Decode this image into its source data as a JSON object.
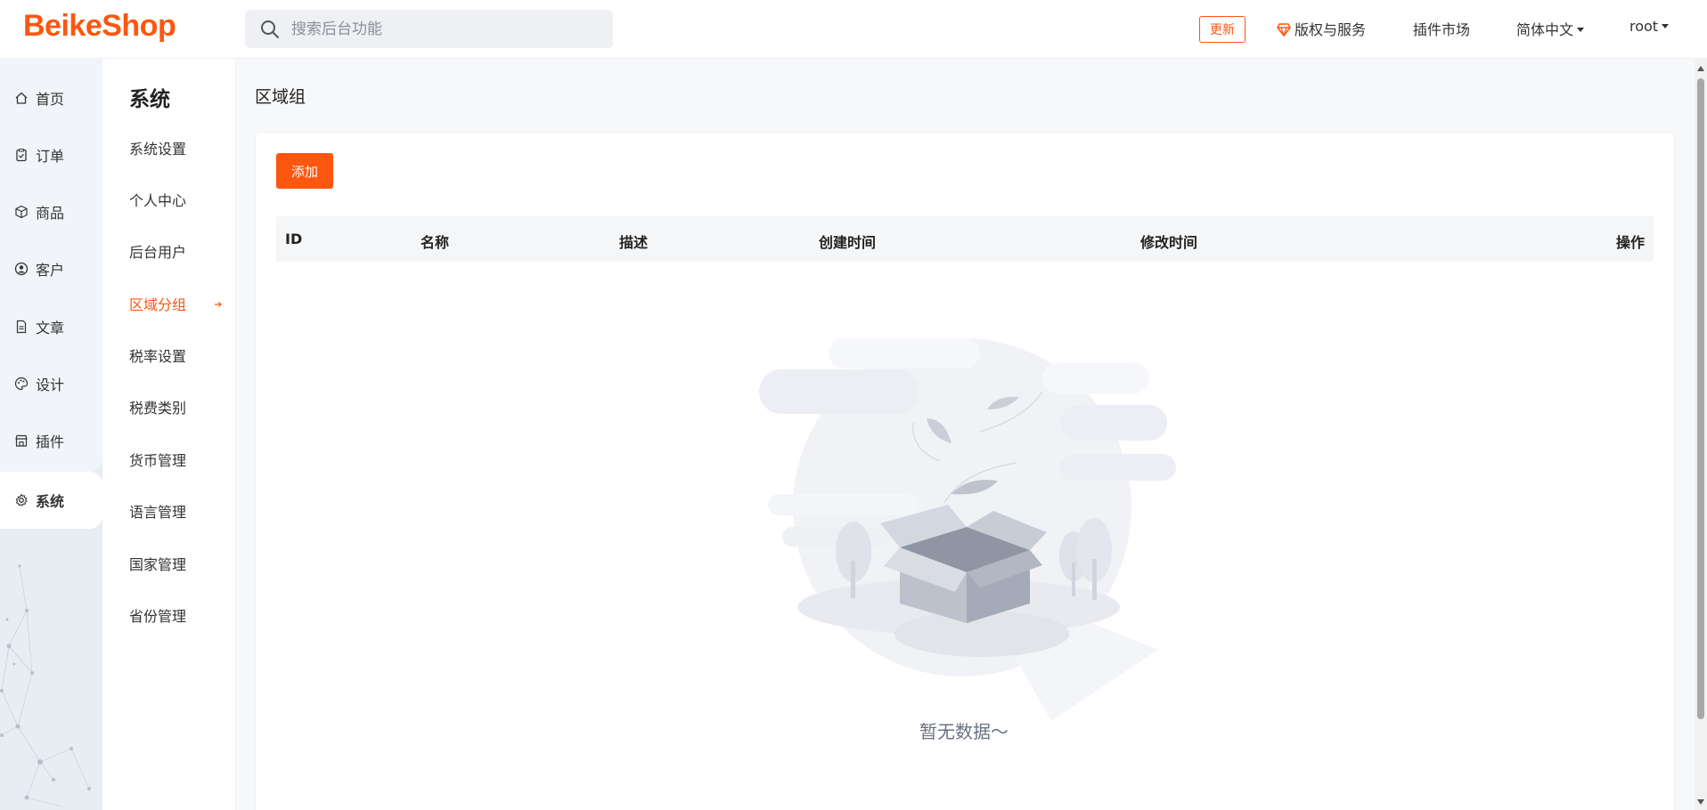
{
  "brand": {
    "logo_text": "BeikeShop",
    "accent": "#fd560f"
  },
  "search": {
    "placeholder": "搜索后台功能",
    "value": ""
  },
  "header": {
    "update_label": "更新",
    "license_label": "版权与服务",
    "plugin_market_label": "插件市场",
    "language_label": "简体中文",
    "user_label": "root"
  },
  "rail": {
    "items": [
      {
        "label": "首页",
        "icon": "home-icon"
      },
      {
        "label": "订单",
        "icon": "clipboard-icon"
      },
      {
        "label": "商品",
        "icon": "box-icon"
      },
      {
        "label": "客户",
        "icon": "user-circle-icon"
      },
      {
        "label": "文章",
        "icon": "document-icon"
      },
      {
        "label": "设计",
        "icon": "palette-icon"
      },
      {
        "label": "插件",
        "icon": "store-icon"
      },
      {
        "label": "系统",
        "icon": "gear-icon",
        "active": true
      }
    ]
  },
  "submenu": {
    "title": "系统",
    "items": [
      {
        "label": "系统设置"
      },
      {
        "label": "个人中心"
      },
      {
        "label": "后台用户"
      },
      {
        "label": "区域分组",
        "active": true
      },
      {
        "label": "税率设置"
      },
      {
        "label": "税费类别"
      },
      {
        "label": "货币管理"
      },
      {
        "label": "语言管理"
      },
      {
        "label": "国家管理"
      },
      {
        "label": "省份管理"
      }
    ]
  },
  "main": {
    "page_title": "区域组",
    "add_button_label": "添加",
    "table": {
      "columns": [
        "ID",
        "名称",
        "描述",
        "创建时间",
        "修改时间",
        "操作"
      ],
      "rows": []
    },
    "empty_text": "暂无数据～"
  }
}
